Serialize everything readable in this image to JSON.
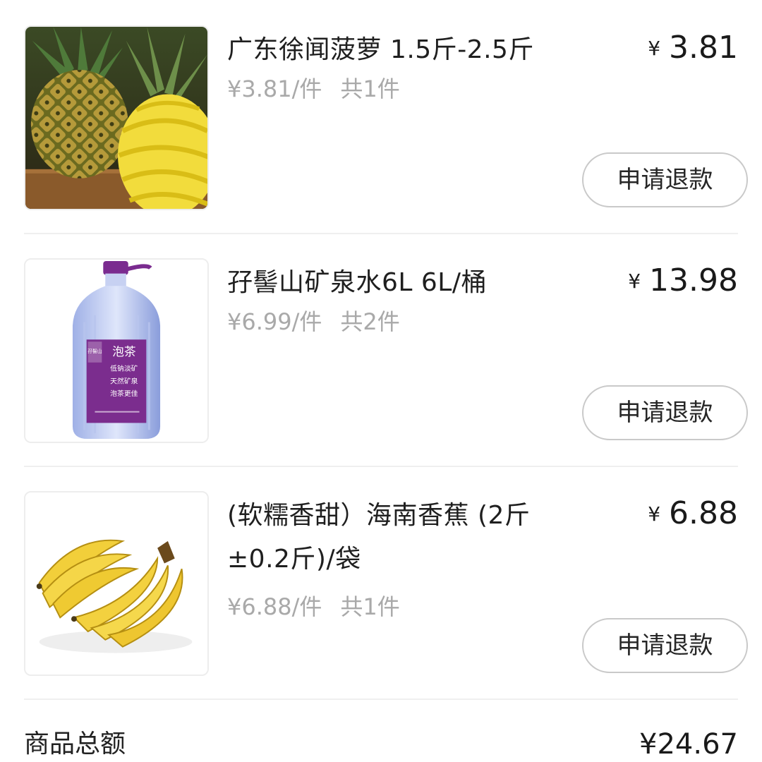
{
  "currency_symbol": "¥",
  "items": [
    {
      "name": "广东徐闻菠萝 1.5斤-2.5斤",
      "unit_price": "¥3.81/件",
      "quantity": "共1件",
      "price": "3.81",
      "refund_label": "申请退款",
      "image": "pineapple"
    },
    {
      "name": "孖髻山矿泉水6L 6L/桶",
      "unit_price": "¥6.99/件",
      "quantity": "共2件",
      "price": "13.98",
      "refund_label": "申请退款",
      "image": "mineral-water-bottle",
      "image_text": {
        "brand": "孖髻山",
        "title": "泡茶",
        "lines": [
          "低钠淡矿",
          "天然矿泉",
          "泡茶更佳"
        ]
      }
    },
    {
      "name": "(软糯香甜）海南香蕉 (2斤±0.2斤)/袋",
      "unit_price": "¥6.88/件",
      "quantity": "共1件",
      "price": "6.88",
      "refund_label": "申请退款",
      "image": "bananas"
    }
  ],
  "summary": {
    "total_label": "商品总额",
    "total_value": "¥24.67"
  },
  "colors": {
    "text_primary": "#1f1f1f",
    "text_secondary": "#a9a9a9",
    "button_border": "#c9c9c9",
    "divider": "#efefef"
  }
}
